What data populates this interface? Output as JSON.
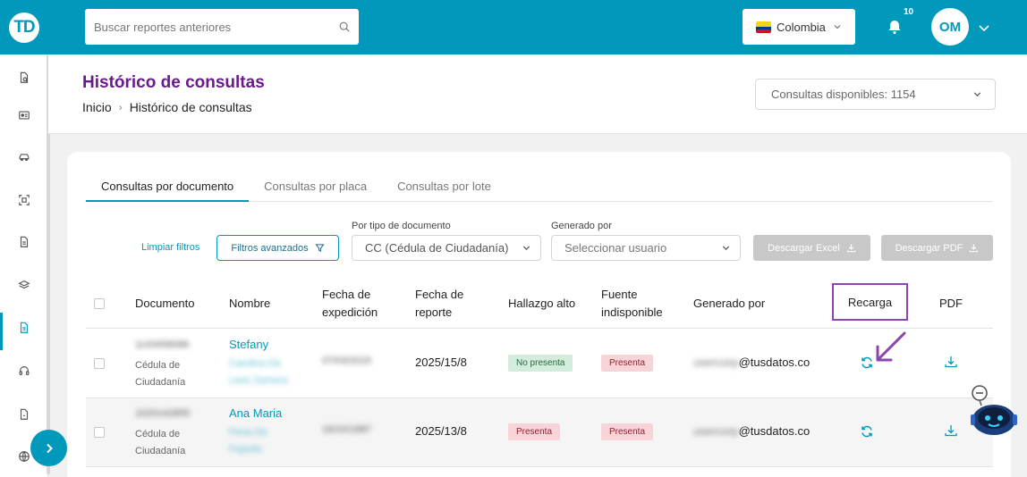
{
  "app": {
    "logo_text": "TD",
    "colors": {
      "brand": "#0099bb",
      "accent": "#6a1b8a",
      "highlight": "#8e44ad"
    }
  },
  "sidebar": {
    "items": [
      {
        "icon": "document-search-icon"
      },
      {
        "icon": "id-card-icon"
      },
      {
        "icon": "car-icon"
      },
      {
        "icon": "scan-icon"
      },
      {
        "icon": "document-icon"
      },
      {
        "icon": "layers-icon"
      },
      {
        "icon": "report-icon",
        "active": true
      },
      {
        "icon": "headset-icon"
      },
      {
        "icon": "file-icon"
      },
      {
        "icon": "globe-icon"
      }
    ]
  },
  "topbar": {
    "search_placeholder": "Buscar reportes anteriores",
    "country": "Colombia",
    "notifications_count": "10",
    "user_initials": "OM"
  },
  "header": {
    "title": "Histórico de consultas",
    "breadcrumb": {
      "home": "Inicio",
      "current": "Histórico de consultas"
    },
    "credits": "Consultas disponibles: 1154"
  },
  "tabs": [
    {
      "label": "Consultas por documento",
      "active": true
    },
    {
      "label": "Consultas por placa"
    },
    {
      "label": "Consultas por lote"
    }
  ],
  "filters": {
    "clear_label": "Limpiar filtros",
    "advanced_label": "Filtros avanzados",
    "doc_type_label": "Por tipo de documento",
    "doc_type_value": "CC (Cédula de Ciudadanía)",
    "generated_by_label": "Generado por",
    "generated_by_placeholder": "Seleccionar usuario",
    "excel_label": "Descargar Excel",
    "pdf_label": "Descargar PDF"
  },
  "table": {
    "columns": {
      "documento": "Documento",
      "nombre": "Nombre",
      "fecha_exp_1": "Fecha de",
      "fecha_exp_2": "expedición",
      "fecha_rep_1": "Fecha de",
      "fecha_rep_2": "reporte",
      "hallazgo": "Hallazgo alto",
      "fuente_1": "Fuente",
      "fuente_2": "indisponible",
      "generado": "Generado por",
      "recarga": "Recarga",
      "pdf": "PDF"
    },
    "rows": [
      {
        "doc_id": "1143458086",
        "doc_type": "Cédula de Ciudadanía",
        "name_first": "Stefany",
        "name_rest": "Carolina De Leon Zamora",
        "fecha_exp": "07/03/2015",
        "fecha_rep": "2025/15/8",
        "hallazgo": "No presenta",
        "fuente": "Presenta",
        "gen_user": "usercorp",
        "gen_domain": "@tusdatos.co"
      },
      {
        "doc_id": "1020142855",
        "doc_type": "Cédula de Ciudadanía",
        "name_first": "Ana Maria",
        "name_rest": "Pena De Fajardo",
        "fecha_exp": "16/10/1987",
        "fecha_rep": "2025/13/8",
        "hallazgo": "Presenta",
        "fuente": "Presenta",
        "gen_user": "usercorp",
        "gen_domain": "@tusdatos.co"
      }
    ]
  }
}
